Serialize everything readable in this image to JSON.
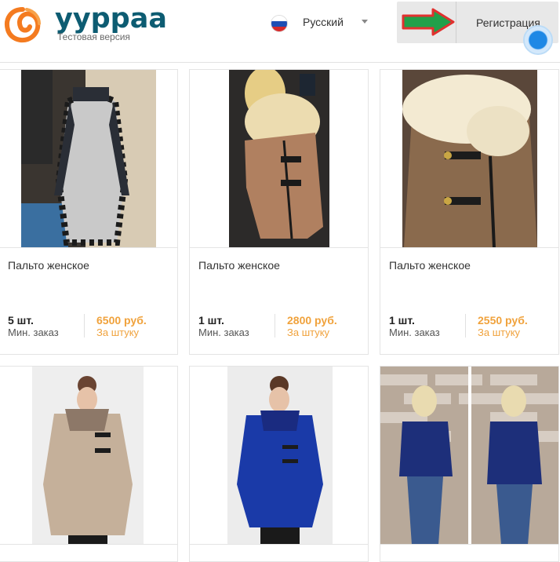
{
  "header": {
    "brand": "yyppaa",
    "tagline": "Тестовая версия",
    "language": "Русский",
    "register_label": "Регистрация"
  },
  "colors": {
    "brand": "#0d5c72",
    "logo": "#f47b20",
    "price": "#f0a23c",
    "arrow": "#21a04a"
  },
  "icons": {
    "logo": "orange-swirl-logo-icon",
    "flag": "russia-flag-icon",
    "caret": "chevron-down-icon",
    "arrow": "green-arrow-icon"
  },
  "products": [
    {
      "title": "Пальто женское",
      "qty": "5 шт.",
      "min_order": "Мин. заказ",
      "price": "6500 руб.",
      "per_unit": "За штуку"
    },
    {
      "title": "Пальто женское",
      "qty": "1 шт.",
      "min_order": "Мин. заказ",
      "price": "2800 руб.",
      "per_unit": "За штуку"
    },
    {
      "title": "Пальто женское",
      "qty": "1 шт.",
      "min_order": "Мин. заказ",
      "price": "2550 руб.",
      "per_unit": "За штуку"
    },
    {
      "title": "",
      "qty": "",
      "min_order": "",
      "price": "",
      "per_unit": ""
    },
    {
      "title": "",
      "qty": "",
      "min_order": "",
      "price": "",
      "per_unit": ""
    },
    {
      "title": "",
      "qty": "",
      "min_order": "",
      "price": "",
      "per_unit": ""
    }
  ]
}
